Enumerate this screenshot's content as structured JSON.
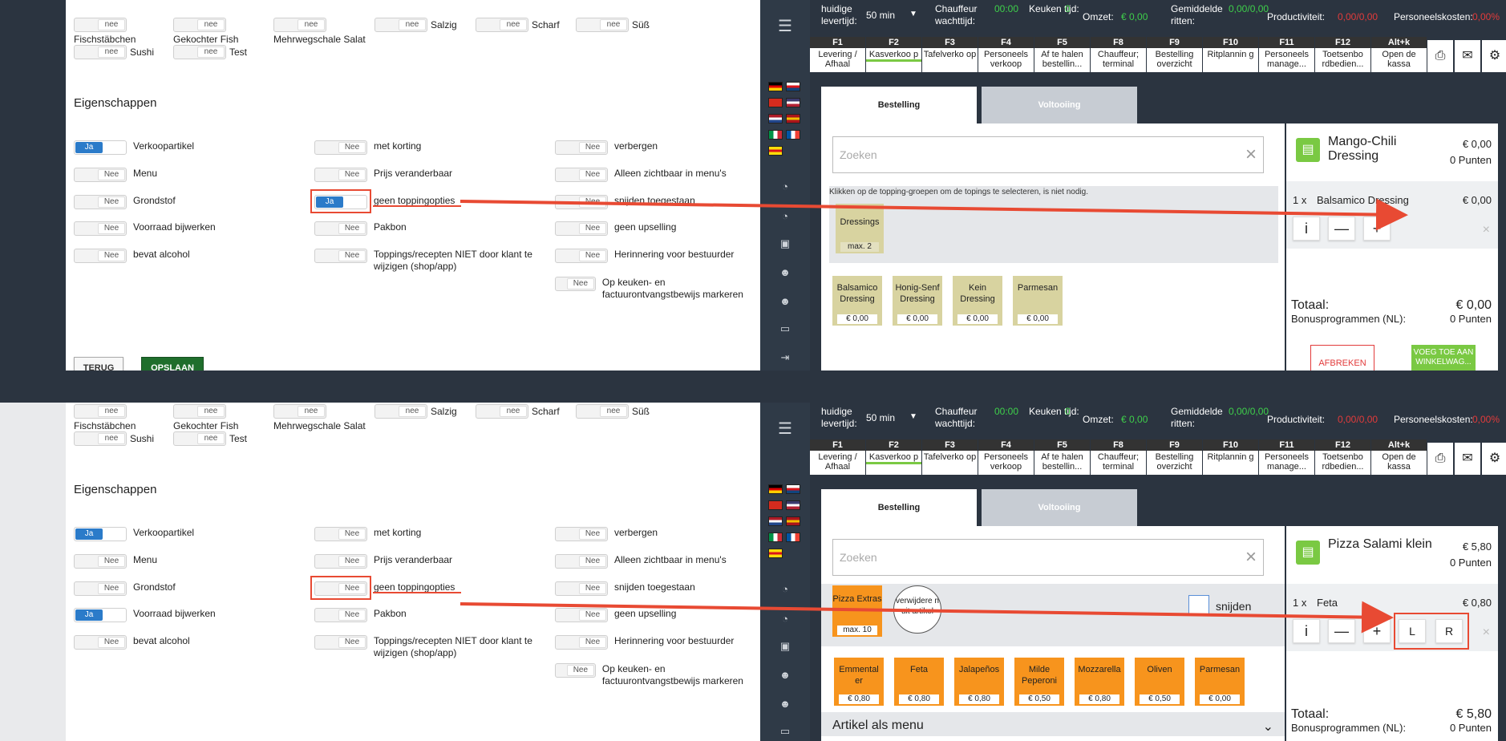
{
  "allergens": {
    "row1": [
      {
        "v": "nee",
        "label": "Fischstäbchen"
      },
      {
        "v": "nee",
        "label": "Gekochter Fish"
      },
      {
        "v": "nee",
        "label": "Mehrwegschale Salat"
      },
      {
        "v": "nee",
        "label": "Salzig"
      },
      {
        "v": "nee",
        "label": "Scharf"
      },
      {
        "v": "nee",
        "label": "Süß"
      }
    ],
    "row2": [
      {
        "v": "nee",
        "label": "Sushi"
      },
      {
        "v": "nee",
        "label": "Test"
      }
    ]
  },
  "eigenschappen_title": "Eigenschappen",
  "props_top": [
    {
      "v": "Ja",
      "label": "Verkoopartikel"
    },
    {
      "v": "Nee",
      "label": "met korting"
    },
    {
      "v": "Nee",
      "label": "verbergen"
    },
    {
      "v": "Nee",
      "label": "Menu"
    },
    {
      "v": "Nee",
      "label": "Prijs veranderbaar"
    },
    {
      "v": "Nee",
      "label": "Alleen zichtbaar in menu's"
    },
    {
      "v": "Nee",
      "label": "Grondstof"
    },
    {
      "v": "Ja",
      "label": "geen toppingopties"
    },
    {
      "v": "Nee",
      "label": "snijden toegestaan"
    },
    {
      "v": "Nee",
      "label": "Voorraad bijwerken"
    },
    {
      "v": "Nee",
      "label": "Pakbon"
    },
    {
      "v": "Nee",
      "label": "geen upselling"
    },
    {
      "v": "Nee",
      "label": "bevat alcohol"
    },
    {
      "v": "Nee",
      "label": "Toppings/recepten NIET door klant te wijzigen (shop/app)"
    },
    {
      "v": "Nee",
      "label": "Herinnering voor bestuurder"
    },
    {
      "v": "Nee",
      "label": "Op keuken- en factuurontvangstbewijs markeren"
    }
  ],
  "props_bot": [
    {
      "v": "Ja",
      "label": "Verkoopartikel"
    },
    {
      "v": "Nee",
      "label": "met korting"
    },
    {
      "v": "Nee",
      "label": "verbergen"
    },
    {
      "v": "Nee",
      "label": "Menu"
    },
    {
      "v": "Nee",
      "label": "Prijs veranderbaar"
    },
    {
      "v": "Nee",
      "label": "Alleen zichtbaar in menu's"
    },
    {
      "v": "Nee",
      "label": "Grondstof"
    },
    {
      "v": "Nee",
      "label": "geen toppingopties"
    },
    {
      "v": "Nee",
      "label": "snijden toegestaan"
    },
    {
      "v": "Ja",
      "label": "Voorraad bijwerken"
    },
    {
      "v": "Nee",
      "label": "Pakbon"
    },
    {
      "v": "Nee",
      "label": "geen upselling"
    },
    {
      "v": "Nee",
      "label": "bevat alcohol"
    },
    {
      "v": "Nee",
      "label": "Toppings/recepten NIET door klant te wijzigen (shop/app)"
    },
    {
      "v": "Nee",
      "label": "Herinnering voor bestuurder"
    },
    {
      "v": "Nee",
      "label": "Op keuken- en factuurontvangstbewijs markeren"
    }
  ],
  "buttons": {
    "back": "TERUG",
    "save": "OPSLAAN"
  },
  "status": {
    "levertijd_label": "huidige levertijd:",
    "levertijd_value": "50 min",
    "chauffeur_label": "Chauffeur wachttijd:",
    "chauffeur_value": "00:00",
    "keuken_label": "Keuken tijd:",
    "keuken_value": "0",
    "omzet_label": "Omzet:",
    "omzet_value": "€ 0,00",
    "gem_label": "Gemiddelde ritten:",
    "gem_value": "0,00/0,00",
    "prod_label": "Productiviteit:",
    "prod_value": "0,00/0,00",
    "pers_label": "Personeelskosten:",
    "pers_value": "0,00%"
  },
  "fkeys": [
    {
      "k": "F1",
      "l": "Levering / Afhaal"
    },
    {
      "k": "F2",
      "l": "Kasverkoo p"
    },
    {
      "k": "F3",
      "l": "Tafelverko op"
    },
    {
      "k": "F4",
      "l": "Personeels verkoop"
    },
    {
      "k": "F5",
      "l": "Af te halen bestellin..."
    },
    {
      "k": "F8",
      "l": "Chauffeur; terminal"
    },
    {
      "k": "F9",
      "l": "Bestelling overzicht"
    },
    {
      "k": "F10",
      "l": "Ritplannin g"
    },
    {
      "k": "F11",
      "l": "Personeels manage..."
    },
    {
      "k": "F12",
      "l": "Toetsenbo rdbedien..."
    },
    {
      "k": "Alt+k",
      "l": "Open de kassa"
    }
  ],
  "tabs": {
    "order": "Bestelling",
    "done": "Voltooiing"
  },
  "search_placeholder": "Zoeken",
  "top_pos": {
    "hint": "Klikken op de topping-groepen om de topings te selecteren, is niet nodig.",
    "group": {
      "name": "Dressings",
      "max": "max. 2"
    },
    "toppings": [
      {
        "n": "Balsamico Dressing",
        "p": "€ 0,00"
      },
      {
        "n": "Honig-Senf Dressing",
        "p": "€ 0,00"
      },
      {
        "n": "Kein Dressing",
        "p": "€ 0,00"
      },
      {
        "n": "Parmesan",
        "p": "€ 0,00"
      }
    ],
    "cart": {
      "title": "Mango-Chili Dressing",
      "price": "€ 0,00",
      "points": "0 Punten",
      "line_qty": "1 x",
      "line_name": "Balsamico Dressing",
      "line_price": "€ 0,00",
      "total_label": "Totaal:",
      "total": "€ 0,00",
      "bonus_label": "Bonusprogrammen (NL):",
      "bonus": "0 Punten",
      "cancel": "AFBREKEN",
      "add": "VOEG TOE AAN WINKELWAG..."
    }
  },
  "bot_pos": {
    "group": {
      "name": "Pizza Extras",
      "max": "max. 10"
    },
    "remove": "verwijdere n uit artikel",
    "snijden": "snijden",
    "toppings": [
      {
        "n": "Emmental er",
        "p": "€ 0,80"
      },
      {
        "n": "Feta",
        "p": "€ 0,80"
      },
      {
        "n": "Jalapeños",
        "p": "€ 0,80"
      },
      {
        "n": "Milde Peperoni",
        "p": "€ 0,50"
      },
      {
        "n": "Mozzarella",
        "p": "€ 0,80"
      },
      {
        "n": "Oliven",
        "p": "€ 0,50"
      },
      {
        "n": "Parmesan",
        "p": "€ 0,00"
      }
    ],
    "menu_label": "Artikel als menu",
    "cart": {
      "title": "Pizza Salami klein",
      "price": "€ 5,80",
      "points": "0 Punten",
      "line_qty": "1 x",
      "line_name": "Feta",
      "line_price": "€ 0,80",
      "btn_l": "L",
      "btn_r": "R",
      "total_label": "Totaal:",
      "total": "€ 5,80",
      "bonus_label": "Bonusprogrammen (NL):",
      "bonus": "0 Punten"
    }
  },
  "cart_buttons": {
    "info": "i",
    "minus": "—",
    "plus": "+",
    "remove": "×"
  },
  "colors": {
    "accent": "#e84a33",
    "toggle_on": "#2b7bc9",
    "save": "#1f6e2c",
    "topping_top": "#d8d3a0",
    "topping_bot": "#f7941d",
    "cart_green": "#7ac943"
  }
}
